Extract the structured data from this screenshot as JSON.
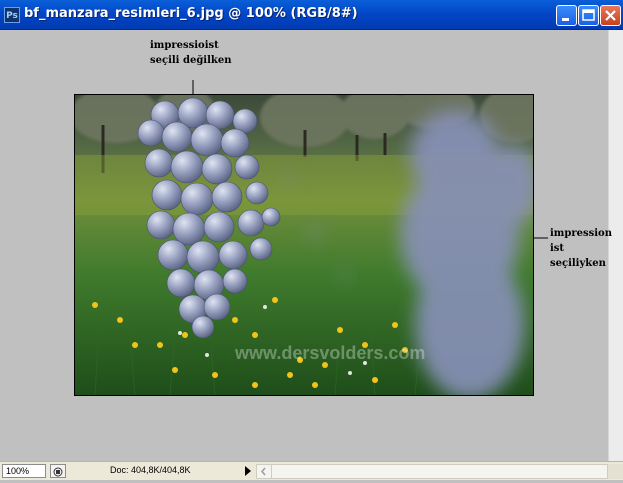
{
  "window": {
    "icon_text": "Ps",
    "title": "bf_manzara_resimleri_6.jpg @ 100% (RGB/8#)"
  },
  "annotations": {
    "left_line1": "impressioist",
    "left_line2": "seçili değilken",
    "right_line1": "impression",
    "right_line2": "ist",
    "right_line3": "seçiliyken"
  },
  "artwork": {
    "watermark": "www.dersvolders.com"
  },
  "statusbar": {
    "zoom": "100%",
    "doc_info": "Doc: 404,8K/404,8K"
  },
  "icons": [
    "photoshop-app-icon",
    "minimize-icon",
    "maximize-icon",
    "close-icon",
    "navigator-icon",
    "triangle-right-icon",
    "chevron-left-icon"
  ]
}
